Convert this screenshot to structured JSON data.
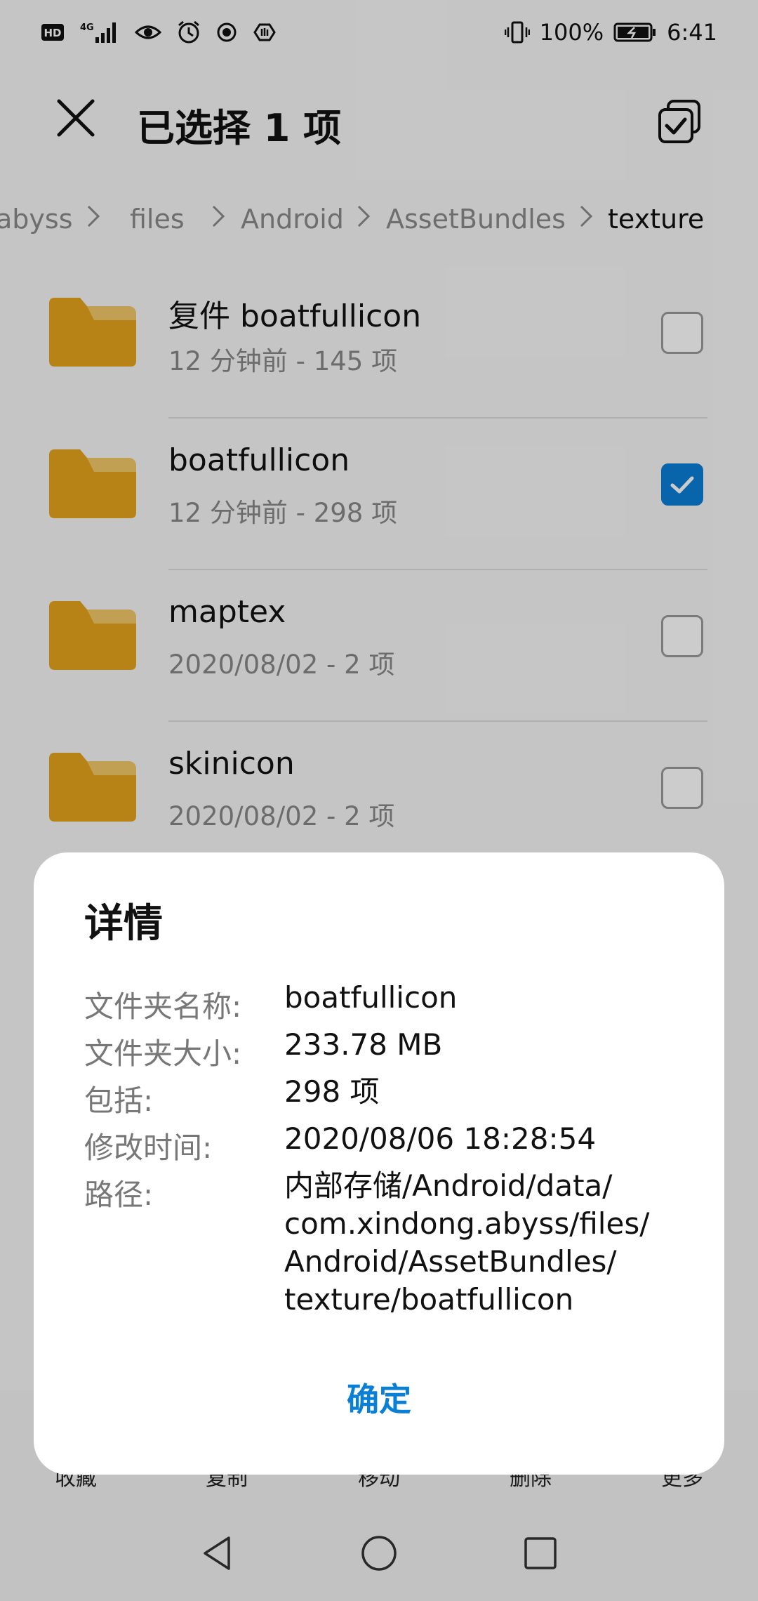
{
  "status_bar": {
    "hd_label": "HD",
    "network_label": "4G",
    "battery_percent": "100%",
    "time": "6:41"
  },
  "app_bar": {
    "title": "已选择 1 项"
  },
  "breadcrumb": {
    "items": [
      "abyss",
      "files",
      "Android",
      "AssetBundles",
      "texture"
    ]
  },
  "file_list": [
    {
      "name": "复件 boatfullicon",
      "meta": "12 分钟前 - 145 项",
      "checked": false
    },
    {
      "name": "boatfullicon",
      "meta": "12 分钟前 - 298 项",
      "checked": true
    },
    {
      "name": "maptex",
      "meta": "2020/08/02 - 2 项",
      "checked": false
    },
    {
      "name": "skinicon",
      "meta": "2020/08/02 - 2 项",
      "checked": false
    }
  ],
  "bottom_toolbar": {
    "items": [
      "收藏",
      "复制",
      "移动",
      "删除",
      "更多"
    ]
  },
  "dialog": {
    "title": "详情",
    "rows": [
      {
        "label": "文件夹名称:",
        "value": "boatfullicon"
      },
      {
        "label": "文件夹大小:",
        "value": "233.78 MB"
      },
      {
        "label": "包括:",
        "value": "298 项"
      },
      {
        "label": "修改时间:",
        "value": "2020/08/06 18:28:54"
      },
      {
        "label": "路径:",
        "value_lines": [
          "内部存储/Android/data/",
          "com.xindong.abyss/files/",
          "Android/AssetBundles/",
          "texture/boatfullicon"
        ]
      }
    ],
    "ok_label": "确定"
  },
  "colors": {
    "accent": "#0a7fd6",
    "folder": "#e6a41c",
    "folder_tab": "#f2c86a"
  }
}
